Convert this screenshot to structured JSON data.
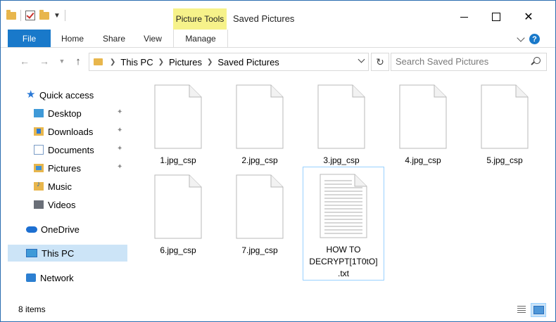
{
  "window": {
    "title": "Saved Pictures",
    "contextual_tab": "Picture Tools",
    "controls": {
      "minimize": "minimize-icon",
      "maximize": "maximize-icon",
      "close": "close-icon"
    }
  },
  "ribbon": {
    "tabs": [
      {
        "label": "File",
        "active": true,
        "color": "#1979ca"
      },
      {
        "label": "Home"
      },
      {
        "label": "Share"
      },
      {
        "label": "View"
      },
      {
        "label": "Manage"
      }
    ],
    "help": "?"
  },
  "address": {
    "crumbs": [
      "This PC",
      "Pictures",
      "Saved Pictures"
    ]
  },
  "search": {
    "placeholder": "Search Saved Pictures"
  },
  "nav": {
    "items": [
      {
        "label": "Quick access",
        "icon": "star-icon"
      },
      {
        "label": "Desktop",
        "icon": "desktop-folder-icon",
        "pinned": true
      },
      {
        "label": "Downloads",
        "icon": "downloads-folder-icon",
        "pinned": true
      },
      {
        "label": "Documents",
        "icon": "documents-folder-icon",
        "pinned": true
      },
      {
        "label": "Pictures",
        "icon": "pictures-folder-icon",
        "pinned": true
      },
      {
        "label": "Music",
        "icon": "music-folder-icon"
      },
      {
        "label": "Videos",
        "icon": "videos-folder-icon"
      },
      {
        "label": "OneDrive",
        "icon": "onedrive-cloud-icon"
      },
      {
        "label": "This PC",
        "icon": "computer-icon",
        "selected": true
      },
      {
        "label": "Network",
        "icon": "network-icon"
      }
    ]
  },
  "files": [
    {
      "name": "1.jpg_csp",
      "icon": "blank-file-icon"
    },
    {
      "name": "2.jpg_csp",
      "icon": "blank-file-icon"
    },
    {
      "name": "3.jpg_csp",
      "icon": "blank-file-icon"
    },
    {
      "name": "4.jpg_csp",
      "icon": "blank-file-icon"
    },
    {
      "name": "5.jpg_csp",
      "icon": "blank-file-icon"
    },
    {
      "name": "6.jpg_csp",
      "icon": "blank-file-icon"
    },
    {
      "name": "7.jpg_csp",
      "icon": "blank-file-icon"
    },
    {
      "name": "HOW TO DECRYPT[1T0tO].txt",
      "icon": "text-file-icon",
      "selected": true
    }
  ],
  "status": {
    "item_count": "8 items",
    "views": [
      "details-view-icon",
      "large-icons-view-icon"
    ]
  }
}
